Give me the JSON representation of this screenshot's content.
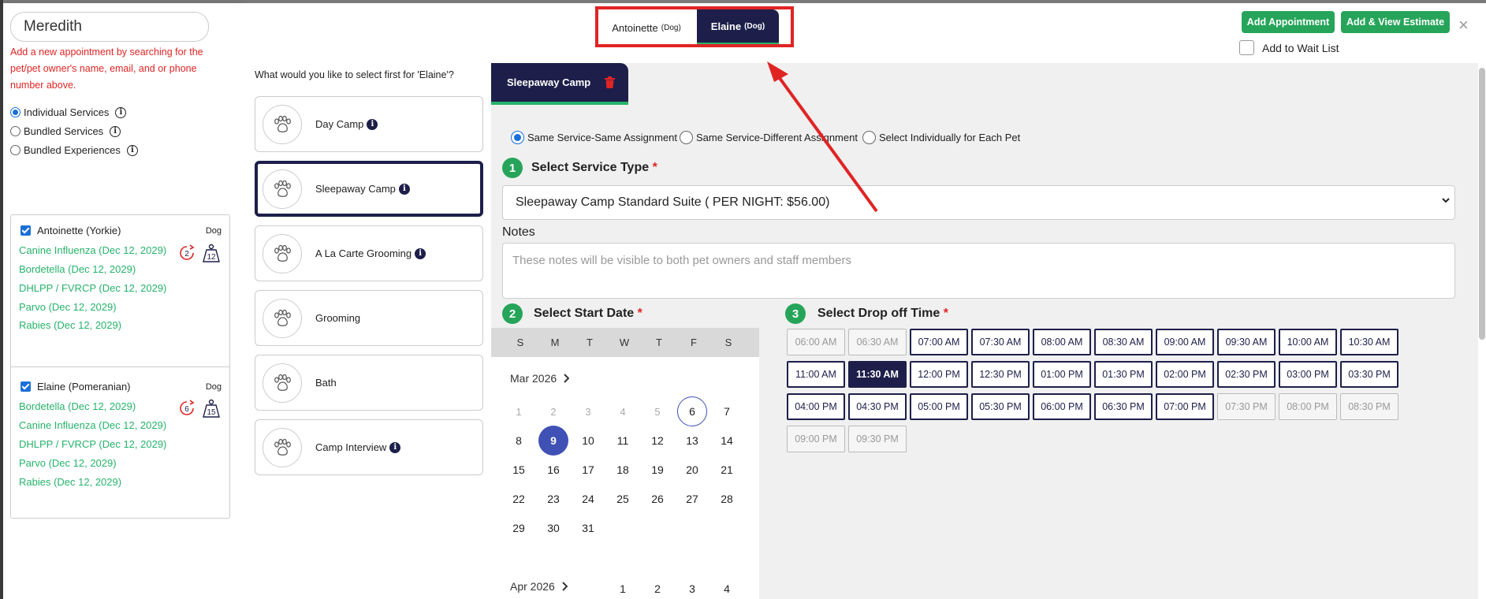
{
  "left": {
    "search_value": "Meredith",
    "search_help": "Add a new appointment by searching for the pet/pet owner's name, email, and or phone number above.",
    "service_modes": [
      {
        "label": "Individual Services",
        "selected": true
      },
      {
        "label": "Bundled Services",
        "selected": false
      },
      {
        "label": "Bundled Experiences",
        "selected": false
      }
    ],
    "pets": [
      {
        "name": "Antoinette (Yorkie)",
        "type": "Dog",
        "refresh_count": "2",
        "weight_count": "12",
        "vaccines": [
          "Canine Influenza (Dec 12, 2029)",
          "Bordetella (Dec 12, 2029)",
          "DHLPP / FVRCP (Dec 12, 2029)",
          "Parvo (Dec 12, 2029)",
          "Rabies (Dec 12, 2029)"
        ]
      },
      {
        "name": "Elaine (Pomeranian)",
        "type": "Dog",
        "refresh_count": "6",
        "weight_count": "15",
        "vaccines": [
          "Bordetella (Dec 12, 2029)",
          "Canine Influenza (Dec 12, 2029)",
          "DHLPP / FVRCP (Dec 12, 2029)",
          "Parvo (Dec 12, 2029)",
          "Rabies (Dec 12, 2029)"
        ]
      }
    ]
  },
  "header": {
    "tabs": [
      {
        "name": "Antoinette",
        "type": "(Dog)"
      },
      {
        "name": "Elaine",
        "type": "(Dog)"
      }
    ],
    "add_appointment": "Add Appointment",
    "add_view_estimate": "Add & View Estimate",
    "close": "×",
    "wait_list": "Add to Wait List"
  },
  "services": {
    "question": "What would you like to select first for 'Elaine'?",
    "items": [
      {
        "label": "Day Camp",
        "info": true
      },
      {
        "label": "Sleepaway Camp",
        "info": true,
        "selected": true
      },
      {
        "label": "A La Carte Grooming",
        "info": true
      },
      {
        "label": "Grooming",
        "info": false
      },
      {
        "label": "Bath",
        "info": false
      },
      {
        "label": "Camp Interview",
        "info": true
      }
    ]
  },
  "detail": {
    "tab_label": "Sleepaway Camp",
    "assignment_options": [
      {
        "label": "Same Service-Same Assignment",
        "selected": true
      },
      {
        "label": "Same Service-Different Assignment",
        "selected": false
      },
      {
        "label": "Select Individually for Each Pet",
        "selected": false
      }
    ],
    "step1_num": "1",
    "step1_title": "Select Service Type",
    "service_type_value": "Sleepaway Camp Standard Suite ( PER NIGHT: $56.00)",
    "notes_label": "Notes",
    "notes_placeholder": "These notes will be visible to both pet owners and staff members",
    "step2_num": "2",
    "step2_title": "Select Start Date",
    "step3_num": "3",
    "step3_title": "Select Drop off Time",
    "required_mark": "*"
  },
  "calendar": {
    "days_of_week": [
      "S",
      "M",
      "T",
      "W",
      "T",
      "F",
      "S"
    ],
    "month1": "Mar 2026",
    "month1_days": [
      "1",
      "2",
      "3",
      "4",
      "5",
      "6",
      "7",
      "8",
      "9",
      "10",
      "11",
      "12",
      "13",
      "14",
      "15",
      "16",
      "17",
      "18",
      "19",
      "20",
      "21",
      "22",
      "23",
      "24",
      "25",
      "26",
      "27",
      "28",
      "29",
      "30",
      "31"
    ],
    "today": "6",
    "selected": "9",
    "month2": "Apr 2026",
    "month2_days": [
      "1",
      "2",
      "3",
      "4"
    ]
  },
  "times": [
    {
      "label": "06:00 AM",
      "state": "disabled"
    },
    {
      "label": "06:30 AM",
      "state": "disabled"
    },
    {
      "label": "07:00 AM",
      "state": "available"
    },
    {
      "label": "07:30 AM",
      "state": "available"
    },
    {
      "label": "08:00 AM",
      "state": "available"
    },
    {
      "label": "08:30 AM",
      "state": "available"
    },
    {
      "label": "09:00 AM",
      "state": "available"
    },
    {
      "label": "09:30 AM",
      "state": "available"
    },
    {
      "label": "10:00 AM",
      "state": "available"
    },
    {
      "label": "10:30 AM",
      "state": "available"
    },
    {
      "label": "11:00 AM",
      "state": "available"
    },
    {
      "label": "11:30 AM",
      "state": "selected"
    },
    {
      "label": "12:00 PM",
      "state": "available"
    },
    {
      "label": "12:30 PM",
      "state": "available"
    },
    {
      "label": "01:00 PM",
      "state": "available"
    },
    {
      "label": "01:30 PM",
      "state": "available"
    },
    {
      "label": "02:00 PM",
      "state": "available"
    },
    {
      "label": "02:30 PM",
      "state": "available"
    },
    {
      "label": "03:00 PM",
      "state": "available"
    },
    {
      "label": "03:30 PM",
      "state": "available"
    },
    {
      "label": "04:00 PM",
      "state": "available"
    },
    {
      "label": "04:30 PM",
      "state": "available"
    },
    {
      "label": "05:00 PM",
      "state": "available"
    },
    {
      "label": "05:30 PM",
      "state": "available"
    },
    {
      "label": "06:00 PM",
      "state": "available"
    },
    {
      "label": "06:30 PM",
      "state": "available"
    },
    {
      "label": "07:00 PM",
      "state": "available"
    },
    {
      "label": "07:30 PM",
      "state": "disabled"
    },
    {
      "label": "08:00 PM",
      "state": "disabled"
    },
    {
      "label": "08:30 PM",
      "state": "disabled"
    },
    {
      "label": "09:00 PM",
      "state": "disabled"
    },
    {
      "label": "09:30 PM",
      "state": "disabled"
    }
  ],
  "colors": {
    "navy": "#1d1f4a",
    "green": "#26a55a",
    "vaccine_green": "#26b36b",
    "alert_red": "#e02424",
    "calendar_blue": "#3f51b5"
  }
}
